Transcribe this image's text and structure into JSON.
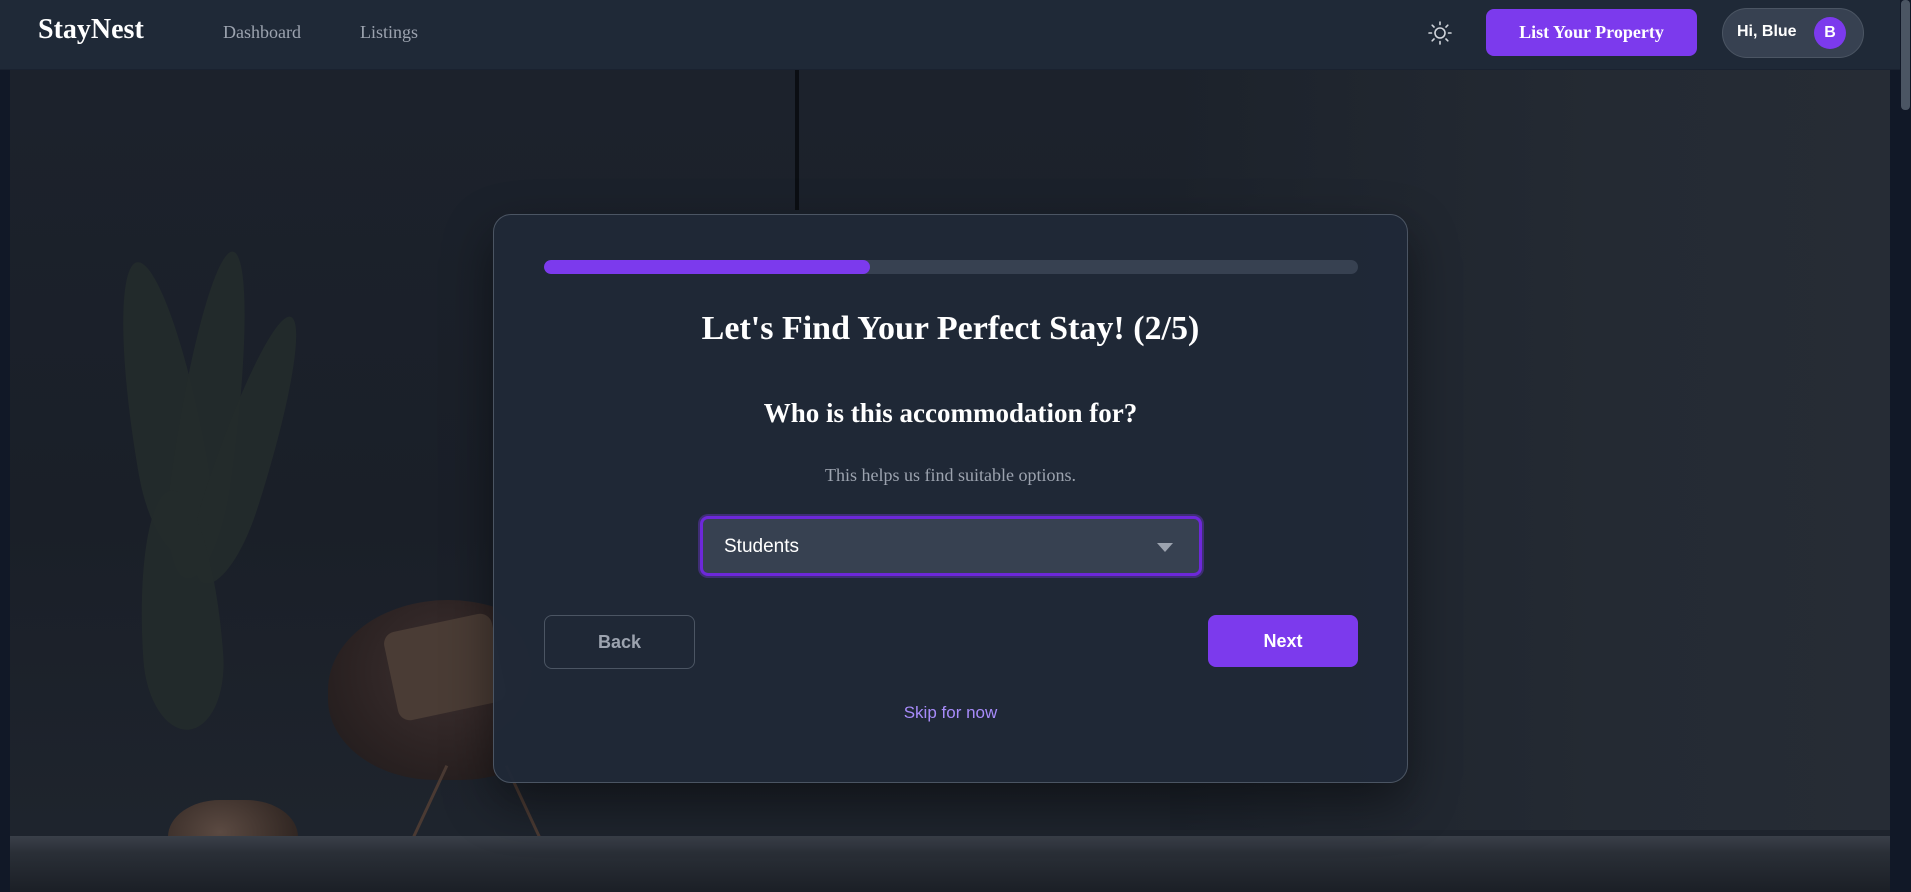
{
  "header": {
    "logo": "StayNest",
    "nav": [
      {
        "label": "Dashboard"
      },
      {
        "label": "Listings"
      }
    ],
    "theme_icon": "sun-icon",
    "list_property_label": "List Your Property",
    "user": {
      "greeting": "Hi, Blue",
      "avatar_initial": "B"
    }
  },
  "onboarding": {
    "progress": 0.4,
    "title": "Let's Find Your Perfect Stay! (2/5)",
    "question": "Who is this accommodation for?",
    "hint": "This helps us find suitable options.",
    "select": {
      "value": "Students",
      "caret_icon": "caret-down-icon"
    },
    "back_label": "Back",
    "next_label": "Next",
    "skip_label": "Skip for now"
  },
  "colors": {
    "accent": "#7c3aed",
    "header_bg": "#1f2937",
    "card_bg": "#1f2937",
    "link": "#a78bfa"
  }
}
